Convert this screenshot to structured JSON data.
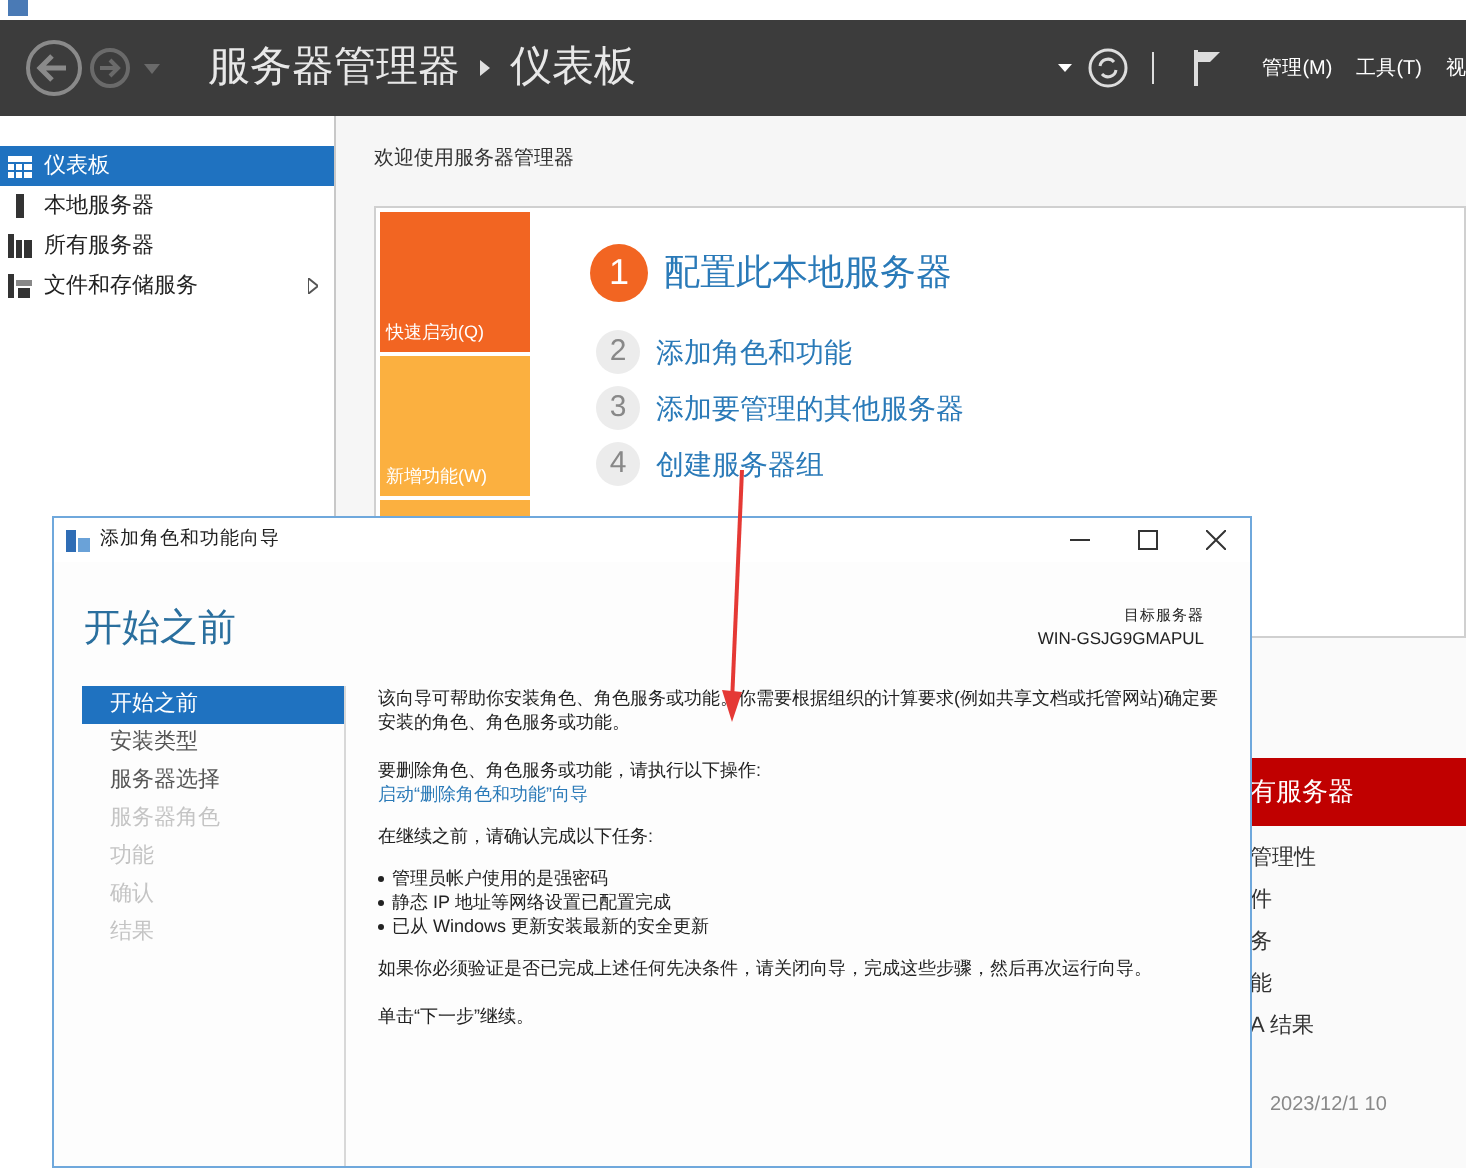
{
  "header": {
    "app_title": "服务器管理器",
    "page_title": "仪表板",
    "menus": [
      "管理(M)",
      "工具(T)",
      "视"
    ]
  },
  "sidebar": {
    "items": [
      {
        "label": "仪表板",
        "selected": true,
        "kind": "dashboard",
        "expandable": false
      },
      {
        "label": "本地服务器",
        "selected": false,
        "kind": "server",
        "expandable": false
      },
      {
        "label": "所有服务器",
        "selected": false,
        "kind": "servers",
        "expandable": false
      },
      {
        "label": "文件和存储服务",
        "selected": false,
        "kind": "storage",
        "expandable": true
      }
    ]
  },
  "welcome": {
    "title": "欢迎使用服务器管理器",
    "tiles": [
      {
        "label": "快速启动(Q)",
        "color": "#f26522"
      },
      {
        "label": "新增功能(W)",
        "color": "#fbb040"
      },
      {
        "color": "#fbb040"
      }
    ],
    "steps": [
      {
        "number": "1",
        "label": "配置此本地服务器",
        "primary": true
      },
      {
        "number": "2",
        "label": "添加角色和功能",
        "primary": false
      },
      {
        "number": "3",
        "label": "添加要管理的其他服务器",
        "primary": false
      },
      {
        "number": "4",
        "label": "创建服务器组",
        "primary": false
      }
    ]
  },
  "background_panel": {
    "title": "有服务器",
    "items": [
      "管理性",
      "件",
      "务",
      "能",
      "A 结果"
    ],
    "timestamp": "2023/12/1 10"
  },
  "dialog": {
    "title": "添加角色和功能向导",
    "heading": "开始之前",
    "target_label": "目标服务器",
    "target_server": "WIN-GSJG9GMAPUL",
    "steps": [
      {
        "label": "开始之前",
        "selected": true,
        "disabled": false
      },
      {
        "label": "安装类型",
        "selected": false,
        "disabled": false
      },
      {
        "label": "服务器选择",
        "selected": false,
        "disabled": false
      },
      {
        "label": "服务器角色",
        "selected": false,
        "disabled": true
      },
      {
        "label": "功能",
        "selected": false,
        "disabled": true
      },
      {
        "label": "确认",
        "selected": false,
        "disabled": true
      },
      {
        "label": "结果",
        "selected": false,
        "disabled": true
      }
    ],
    "intro": "该向导可帮助你安装角色、角色服务或功能。你需要根据组织的计算要求(例如共享文档或托管网站)确定要安装的角色、角色服务或功能。",
    "remove_text": "要删除角色、角色服务或功能，请执行以下操作:",
    "remove_link": "启动“删除角色和功能”向导",
    "prereq_text": "在继续之前，请确认完成以下任务:",
    "prereqs": [
      "管理员帐户使用的是强密码",
      "静态 IP 地址等网络设置已配置完成",
      "已从 Windows 更新安装最新的安全更新"
    ],
    "verify_text": "如果你必须验证是否已完成上述任何先决条件，请关闭向导，完成这些步骤，然后再次运行向导。",
    "next_text": "单击“下一步”继续。"
  }
}
